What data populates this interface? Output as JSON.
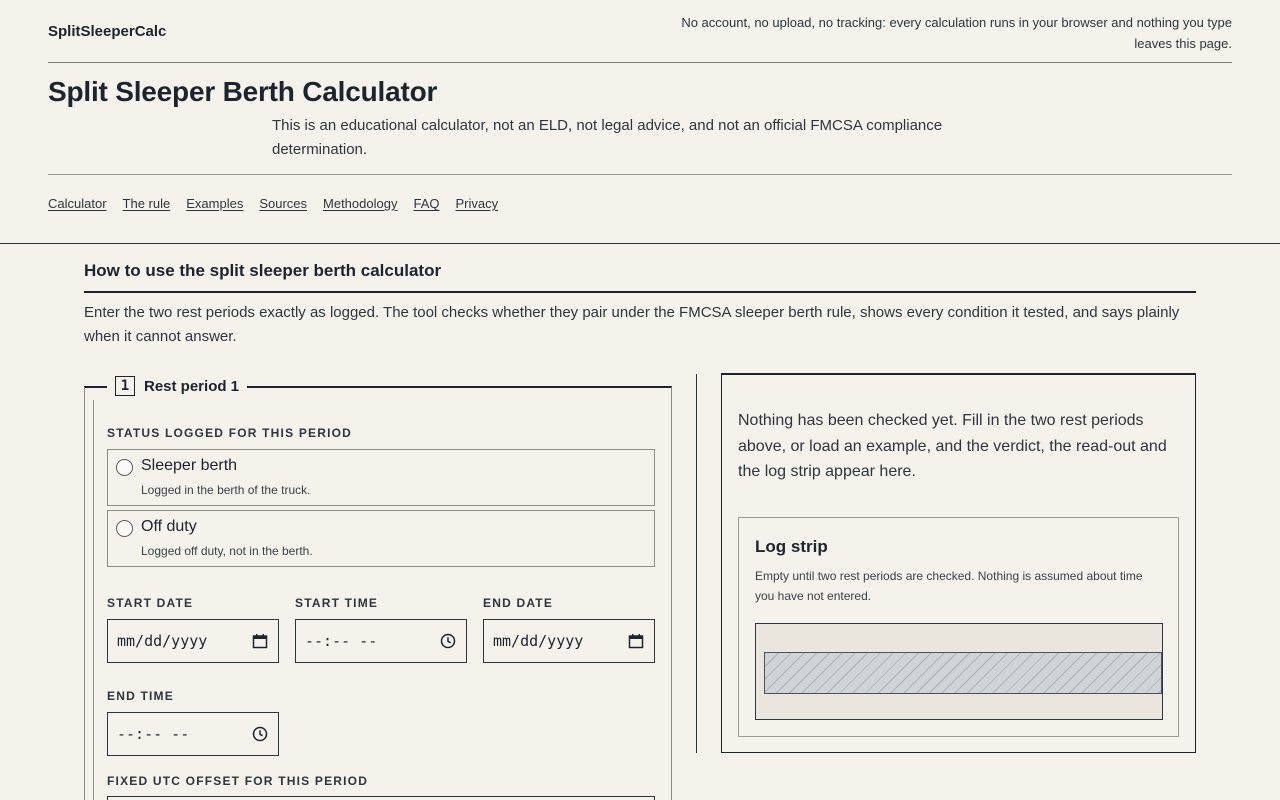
{
  "header": {
    "brand": "SplitSleeperCalc",
    "privacy_note": "No account, no upload, no tracking: every calculation runs in your browser and nothing you type leaves this page."
  },
  "page": {
    "title": "Split Sleeper Berth Calculator",
    "disclaimer": "This is an educational calculator, not an ELD, not legal advice, and not an official FMCSA compliance determination."
  },
  "nav": {
    "items": [
      "Calculator",
      "The rule",
      "Examples",
      "Sources",
      "Methodology",
      "FAQ",
      "Privacy"
    ]
  },
  "section": {
    "title": "How to use the split sleeper berth calculator",
    "intro": "Enter the two rest periods exactly as logged. The tool checks whether they pair under the FMCSA sleeper berth rule, shows every condition it tested, and says plainly when it cannot answer."
  },
  "period1": {
    "number": "1",
    "title": "Rest period 1",
    "status_label": "STATUS LOGGED FOR THIS PERIOD",
    "options": [
      {
        "title": "Sleeper berth",
        "sub": "Logged in the berth of the truck."
      },
      {
        "title": "Off duty",
        "sub": "Logged off duty, not in the berth."
      }
    ],
    "start_date_label": "START DATE",
    "start_date_value": "mm/dd/yyyy",
    "start_time_label": "START TIME",
    "start_time_value": "--:-- --",
    "end_date_label": "END DATE",
    "end_date_value": "mm/dd/yyyy",
    "end_time_label": "END TIME",
    "end_time_value": "--:-- --",
    "utc_label": "FIXED UTC OFFSET FOR THIS PERIOD"
  },
  "result": {
    "message": "Nothing has been checked yet. Fill in the two rest periods above, or load an example, and the verdict, the read-out and the log strip appear here.",
    "strip_title": "Log strip",
    "strip_desc": "Empty until two rest periods are checked. Nothing is assumed about time you have not entered."
  },
  "icons": {
    "calendar": "calendar-icon",
    "clock": "clock-icon"
  },
  "colors": {
    "background": "#f5f2eb",
    "text": "#1c2430",
    "strip_fill": "#cfd4d8"
  }
}
